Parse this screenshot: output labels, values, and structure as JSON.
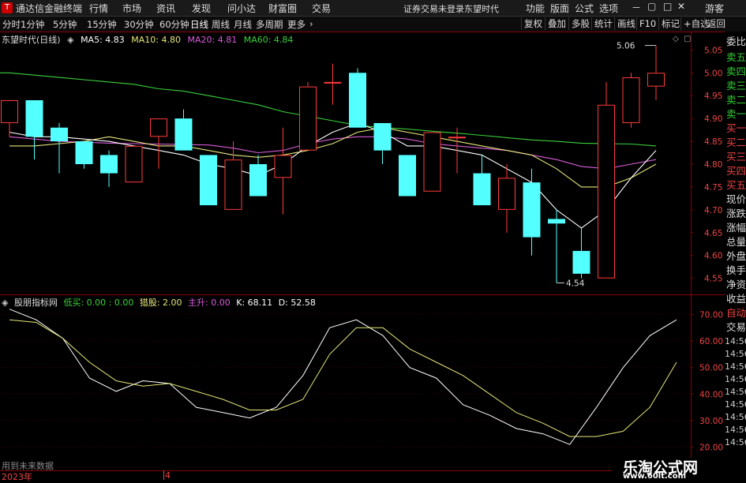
{
  "menubar": {
    "app_title": "通达信金融终端",
    "items": [
      "行情",
      "市场",
      "资讯",
      "发现",
      "问小达",
      "财富圈",
      "交易"
    ],
    "notice": "证券交易未登录",
    "stock": "东望时代",
    "right_items": [
      "功能",
      "版面",
      "公式",
      "选项"
    ],
    "guest": "游客"
  },
  "toolbar": {
    "periods": [
      "分时",
      "1分钟",
      "5分钟",
      "15分钟",
      "30分钟",
      "60分钟",
      "日线",
      "周线",
      "月线",
      "多周期",
      "更多"
    ],
    "active": "日线",
    "right": [
      "复权",
      "叠加",
      "多股",
      "统计",
      "画线",
      "F10",
      "标记",
      "+自选",
      "返回"
    ]
  },
  "main_legend": {
    "title": "东望时代(日线)",
    "ma5": "MA5: 4.83",
    "ma10": "MA10: 4.80",
    "ma20": "MA20: 4.81",
    "ma60": "MA60: 4.84"
  },
  "colors": {
    "up": "#ff3b3b",
    "down": "#54ffff",
    "ma5": "#ffffff",
    "ma10": "#e6e67a",
    "ma20": "#d85cd8",
    "ma60": "#3ad13a"
  },
  "annotations": {
    "high_label": "5.06",
    "low_label": "4.54"
  },
  "chart_data": {
    "type": "candlestick",
    "ylim": [
      4.5,
      5.1
    ],
    "yticks": [
      "5.05",
      "5.00",
      "4.95",
      "4.90",
      "4.85",
      "4.80",
      "4.75",
      "4.70",
      "4.65",
      "4.60",
      "4.55"
    ],
    "candles": [
      {
        "o": 4.89,
        "h": 4.94,
        "l": 4.86,
        "c": 4.94
      },
      {
        "o": 4.94,
        "h": 4.94,
        "l": 4.81,
        "c": 4.86
      },
      {
        "o": 4.88,
        "h": 4.89,
        "l": 4.78,
        "c": 4.85
      },
      {
        "o": 4.85,
        "h": 4.85,
        "l": 4.79,
        "c": 4.8
      },
      {
        "o": 4.82,
        "h": 4.83,
        "l": 4.75,
        "c": 4.78
      },
      {
        "o": 4.76,
        "h": 4.84,
        "l": 4.76,
        "c": 4.84
      },
      {
        "o": 4.86,
        "h": 4.9,
        "l": 4.79,
        "c": 4.9
      },
      {
        "o": 4.9,
        "h": 4.92,
        "l": 4.83,
        "c": 4.83
      },
      {
        "o": 4.82,
        "h": 4.82,
        "l": 4.71,
        "c": 4.71
      },
      {
        "o": 4.7,
        "h": 4.85,
        "l": 4.7,
        "c": 4.81
      },
      {
        "o": 4.8,
        "h": 4.82,
        "l": 4.73,
        "c": 4.73
      },
      {
        "o": 4.77,
        "h": 4.88,
        "l": 4.69,
        "c": 4.82
      },
      {
        "o": 4.83,
        "h": 4.98,
        "l": 4.83,
        "c": 4.97
      },
      {
        "o": 4.98,
        "h": 5.02,
        "l": 4.93,
        "c": 4.98
      },
      {
        "o": 5.0,
        "h": 5.01,
        "l": 4.88,
        "c": 4.88
      },
      {
        "o": 4.89,
        "h": 4.89,
        "l": 4.8,
        "c": 4.83
      },
      {
        "o": 4.82,
        "h": 4.82,
        "l": 4.73,
        "c": 4.73
      },
      {
        "o": 4.74,
        "h": 4.87,
        "l": 4.74,
        "c": 4.87
      },
      {
        "o": 4.86,
        "h": 4.88,
        "l": 4.78,
        "c": 4.86
      },
      {
        "o": 4.78,
        "h": 4.82,
        "l": 4.71,
        "c": 4.71
      },
      {
        "o": 4.7,
        "h": 4.8,
        "l": 4.65,
        "c": 4.77
      },
      {
        "o": 4.76,
        "h": 4.79,
        "l": 4.6,
        "c": 4.64
      },
      {
        "o": 4.68,
        "h": 4.7,
        "l": 4.54,
        "c": 4.67
      },
      {
        "o": 4.61,
        "h": 4.66,
        "l": 4.55,
        "c": 4.56
      },
      {
        "o": 4.55,
        "h": 4.98,
        "l": 4.55,
        "c": 4.93
      },
      {
        "o": 4.89,
        "h": 5.0,
        "l": 4.88,
        "c": 4.99
      },
      {
        "o": 4.97,
        "h": 5.06,
        "l": 4.94,
        "c": 5.0
      }
    ],
    "ma5": [
      4.87,
      4.86,
      4.86,
      4.855,
      4.85,
      4.84,
      4.83,
      4.82,
      4.8,
      4.79,
      4.775,
      4.8,
      4.84,
      4.87,
      4.89,
      4.87,
      4.84,
      4.84,
      4.83,
      4.82,
      4.79,
      4.76,
      4.7,
      4.66,
      4.7,
      4.77,
      4.83
    ],
    "ma10": [
      4.84,
      4.84,
      4.845,
      4.85,
      4.86,
      4.85,
      4.84,
      4.84,
      4.83,
      4.82,
      4.815,
      4.82,
      4.83,
      4.845,
      4.87,
      4.88,
      4.87,
      4.86,
      4.85,
      4.84,
      4.83,
      4.82,
      4.79,
      4.75,
      4.75,
      4.77,
      4.8
    ],
    "ma20": [
      4.86,
      4.855,
      4.85,
      4.848,
      4.846,
      4.845,
      4.844,
      4.843,
      4.842,
      4.835,
      4.825,
      4.83,
      4.845,
      4.855,
      4.86,
      4.86,
      4.855,
      4.845,
      4.84,
      4.835,
      4.83,
      4.82,
      4.81,
      4.795,
      4.79,
      4.8,
      4.81
    ],
    "ma60": [
      5.0,
      4.995,
      4.99,
      4.985,
      4.98,
      4.975,
      4.965,
      4.96,
      4.95,
      4.94,
      4.93,
      4.915,
      4.905,
      4.895,
      4.885,
      4.88,
      4.877,
      4.872,
      4.868,
      4.863,
      4.858,
      4.853,
      4.85,
      4.846,
      4.845,
      4.844,
      4.84
    ],
    "indicator": {
      "ylim": [
        18,
        72
      ],
      "yticks": [
        "70.00",
        "60.00",
        "50.00",
        "40.00",
        "30.00",
        "20.00"
      ],
      "K": [
        72,
        68,
        61,
        46,
        41,
        45,
        44,
        35,
        33,
        31,
        35,
        47,
        65,
        68,
        62,
        50,
        46,
        36,
        32,
        27,
        25,
        21,
        35,
        50,
        62,
        68
      ],
      "D": [
        68,
        67,
        61,
        52,
        45,
        43,
        44,
        41,
        38,
        34,
        34,
        38,
        55,
        65,
        65,
        57,
        52,
        47,
        40,
        33,
        29,
        24,
        24,
        26,
        35,
        52
      ]
    }
  },
  "indicator_legend": {
    "name": "股朋指标网",
    "low_buy": "低买: 0.00 : 0.00",
    "hunt": "猎股: 2.00",
    "main_up": "主升: 0.00",
    "k": "K: 68.11",
    "d": "D: 52.58"
  },
  "right_panel": {
    "labels": [
      "委比",
      "卖五",
      "卖四",
      "卖三",
      "卖二",
      "卖一",
      "买一",
      "买二",
      "买三",
      "买四",
      "买五",
      "现价",
      "涨跌",
      "涨幅",
      "总量",
      "外盘",
      "换手",
      "净资",
      "收益"
    ],
    "lower_labels": [
      "自动",
      "交易"
    ],
    "times": [
      "14:56",
      "14:56",
      "14:56",
      "14:56",
      "14:56",
      "14:56",
      "14:56",
      "14:56",
      "14:56"
    ]
  },
  "bottom": {
    "future_text": "用到未来数据",
    "year": "2023年",
    "month": "4"
  },
  "watermark": {
    "title": "乐淘公式网",
    "url": "www.60lt.com"
  }
}
